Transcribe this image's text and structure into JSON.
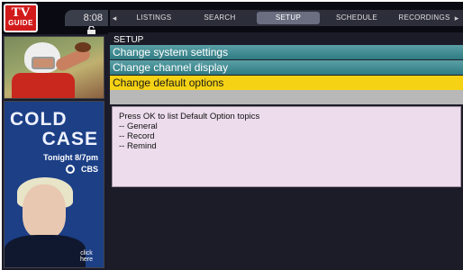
{
  "logo": {
    "line1": "TV",
    "line2": "GUIDE"
  },
  "clock": "8:08",
  "nav": {
    "left_arrow": "◂",
    "right_arrow": "▸",
    "tabs": [
      {
        "label": "LISTINGS",
        "active": false
      },
      {
        "label": "SEARCH",
        "active": false
      },
      {
        "label": "SETUP",
        "active": true
      },
      {
        "label": "SCHEDULE",
        "active": false
      },
      {
        "label": "RECORDINGS",
        "active": false
      }
    ]
  },
  "ad": {
    "title_line1": "COLD",
    "title_line2": "CASE",
    "time": "Tonight 8/7pm",
    "network": "CBS",
    "cta_line1": "click",
    "cta_line2": "here"
  },
  "setup": {
    "title": "SETUP",
    "items": [
      {
        "label": "Change system settings",
        "selected": false
      },
      {
        "label": "Change channel display",
        "selected": false
      },
      {
        "label": "Change default options",
        "selected": true
      }
    ]
  },
  "info": {
    "lines": [
      "Press OK to list Default Option topics",
      "-- General",
      "-- Record",
      "-- Remind"
    ]
  },
  "colors": {
    "selected_item": "#f5d214",
    "menu_item": "#3d8a92",
    "logo_red": "#d21a1a",
    "info_background": "#ecdcec"
  }
}
